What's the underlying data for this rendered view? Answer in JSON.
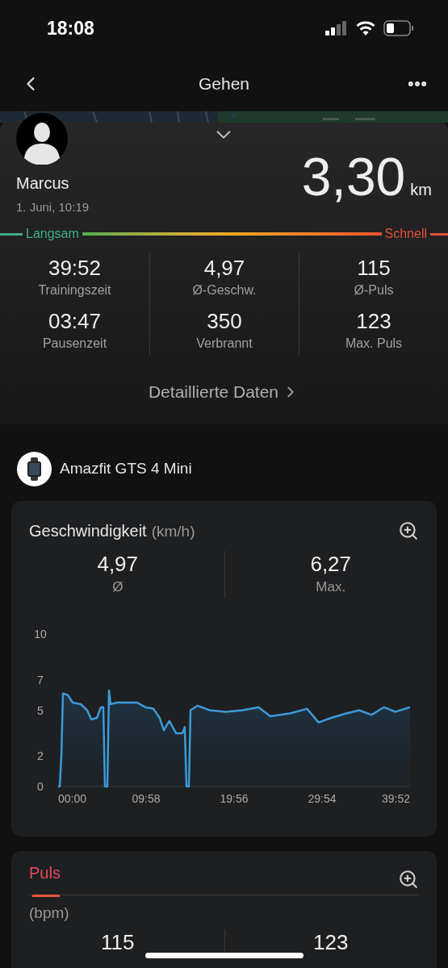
{
  "status_bar": {
    "time": "18:08"
  },
  "nav": {
    "title": "Gehen"
  },
  "summary": {
    "name": "Marcus",
    "date": "1. Juni, 10:19",
    "distance": "3,30",
    "unit": "km",
    "pace_scale": {
      "slow": "Langsam",
      "fast": "Schnell"
    },
    "stats": [
      {
        "value": "39:52",
        "label": "Trainingszeit"
      },
      {
        "value": "4,97",
        "label": "Ø-Geschw."
      },
      {
        "value": "115",
        "label": "Ø-Puls"
      },
      {
        "value": "03:47",
        "label": "Pausenzeit"
      },
      {
        "value": "350",
        "label": "Verbrannt"
      },
      {
        "value": "123",
        "label": "Max. Puls"
      }
    ],
    "details_link": "Detaillierte Daten"
  },
  "device": {
    "name": "Amazfit GTS 4 Mini"
  },
  "speed_card": {
    "title": "Geschwindigkeit",
    "unit": "(km/h)",
    "stats": [
      {
        "value": "4,97",
        "label": "Ø"
      },
      {
        "value": "6,27",
        "label": "Max."
      }
    ],
    "chart_data": {
      "type": "area",
      "x": [
        0,
        0.18,
        0.37,
        0.55,
        1.1,
        1.65,
        2.56,
        3.29,
        3.75,
        4.39,
        4.85,
        5.12,
        5.3,
        5.58,
        5.76,
        5.94,
        6.68,
        8.96,
        9.88,
        10.8,
        11.5,
        11.98,
        12.6,
        13.35,
        14.08,
        14.35,
        14.54,
        14.81,
        15.0,
        15.8,
        17.2,
        19.0,
        20.85,
        22.7,
        24.05,
        26.3,
        28.2,
        29.5,
        30.9,
        32.7,
        34.1,
        35.5,
        36.9,
        38.2,
        39.87
      ],
      "series": [
        {
          "color": "#3d9ad8",
          "values": [
            0,
            0,
            2,
            6.1,
            6.0,
            5.5,
            5.4,
            5.0,
            4.4,
            4.5,
            5.2,
            5.2,
            0,
            0,
            6.3,
            5.4,
            5.5,
            5.5,
            5.2,
            5.1,
            4.5,
            3.7,
            4.3,
            3.5,
            3.5,
            3.9,
            0,
            0,
            5.0,
            5.3,
            5.0,
            4.9,
            5.0,
            5.2,
            4.6,
            4.8,
            5.1,
            4.2,
            4.5,
            4.8,
            5.0,
            4.7,
            5.2,
            4.9,
            5.2
          ]
        }
      ],
      "xlim": [
        0,
        39.87
      ],
      "ylim": [
        0,
        10
      ],
      "xticks": [
        {
          "value": 0,
          "label": "00:00"
        },
        {
          "value": 9.97,
          "label": "09:58"
        },
        {
          "value": 19.93,
          "label": "19:56"
        },
        {
          "value": 29.9,
          "label": "29:54"
        },
        {
          "value": 39.87,
          "label": "39:52"
        }
      ],
      "yticks": [
        0,
        2,
        5,
        7,
        10
      ]
    }
  },
  "pulse_card": {
    "tabs": [
      {
        "label": "Puls",
        "selected": true
      }
    ],
    "unit": "(bpm)",
    "stats": [
      {
        "value": "115"
      },
      {
        "value": "123"
      }
    ]
  }
}
